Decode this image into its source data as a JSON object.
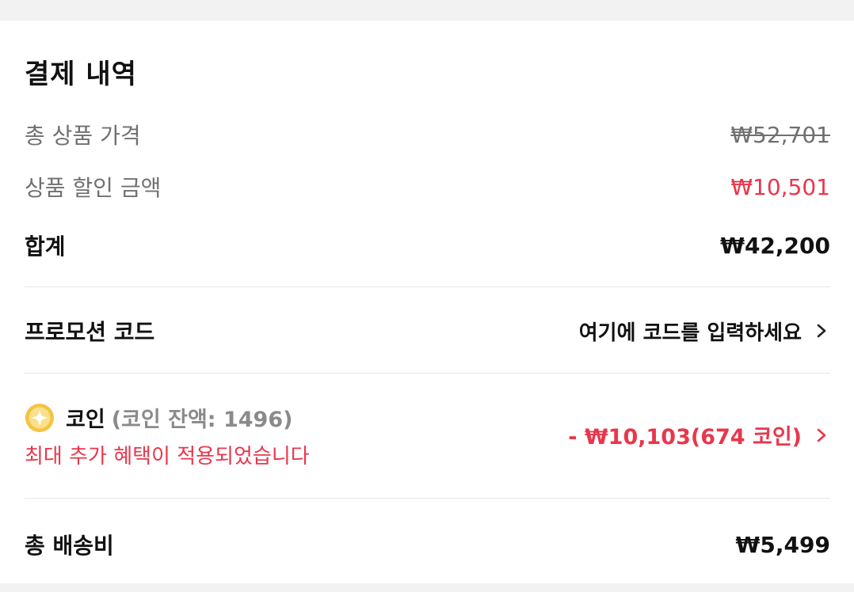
{
  "header": {
    "title": "결제 내역"
  },
  "summary": {
    "total_product_label": "총 상품 가격",
    "total_product_value": "₩52,701",
    "discount_label": "상품 할인 금액",
    "discount_value": "₩10,501",
    "subtotal_label": "합계",
    "subtotal_value": "₩42,200"
  },
  "promo": {
    "label": "프로모션 코드",
    "action_text": "여기에 코드를 입력하세요"
  },
  "coin": {
    "label": "코인",
    "balance_text": "(코인 잔액: 1496)",
    "note": "최대 추가 혜택이 적용되었습니다",
    "deduction": "- ₩10,103(674 코인)"
  },
  "shipping": {
    "label": "총 배송비",
    "value": "₩5,499"
  },
  "colors": {
    "accent_red": "#e8374c",
    "muted_gray": "#707070",
    "coin_gold": "#f5c344"
  }
}
